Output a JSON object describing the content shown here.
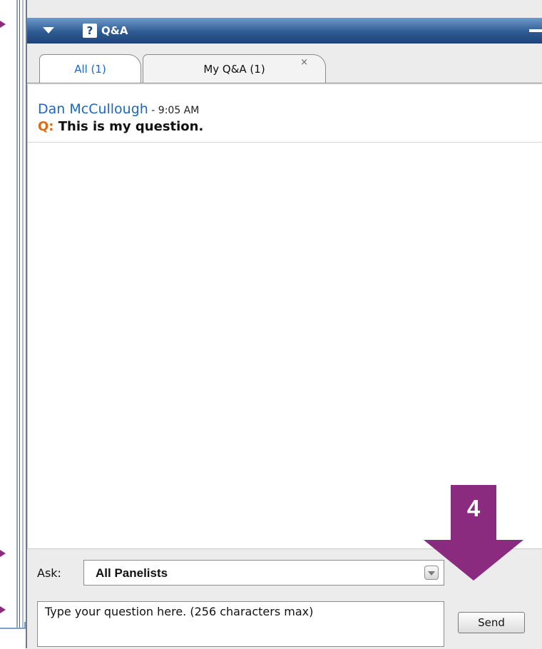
{
  "panel": {
    "title": "Q&A",
    "icon": "question-icon"
  },
  "tabs": [
    {
      "label": "All (1)",
      "active": true
    },
    {
      "label": "My Q&A (1)",
      "active": false,
      "close_glyph": "×"
    }
  ],
  "messages": [
    {
      "author": "Dan McCullough",
      "time_sep": " - ",
      "time": "9:05 AM",
      "q_label": "Q:",
      "text": " This is my question."
    }
  ],
  "ask": {
    "label": "Ask:",
    "selected": "All Panelists"
  },
  "question_input": {
    "placeholder": "Type your question here. (256 characters max)"
  },
  "send_label": "Send",
  "annotation": {
    "step": "4",
    "color": "#8b2b7f"
  },
  "colors": {
    "header": "#2f5b93",
    "author": "#1d66c2",
    "q_label": "#e06b16"
  }
}
